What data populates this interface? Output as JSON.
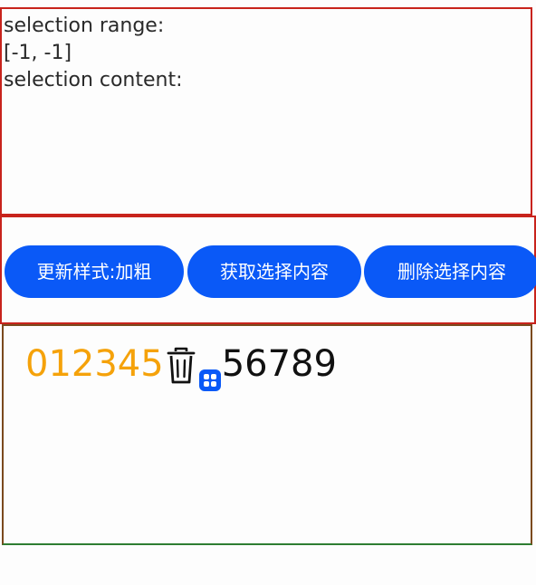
{
  "info": {
    "range_label": "selection range:",
    "range_value": "[-1, -1]",
    "content_label": "selection content:"
  },
  "buttons": {
    "bold": "更新样式:加粗",
    "get_selection": "获取选择内容",
    "delete_selection": "删除选择内容"
  },
  "editor": {
    "styled_text": "012345",
    "plain_text": "56789",
    "styled_color": "#f5a20a",
    "icons": [
      "trash-icon",
      "grid-icon"
    ]
  },
  "colors": {
    "accent": "#0a59f7",
    "panel_border": "#c8231c"
  }
}
